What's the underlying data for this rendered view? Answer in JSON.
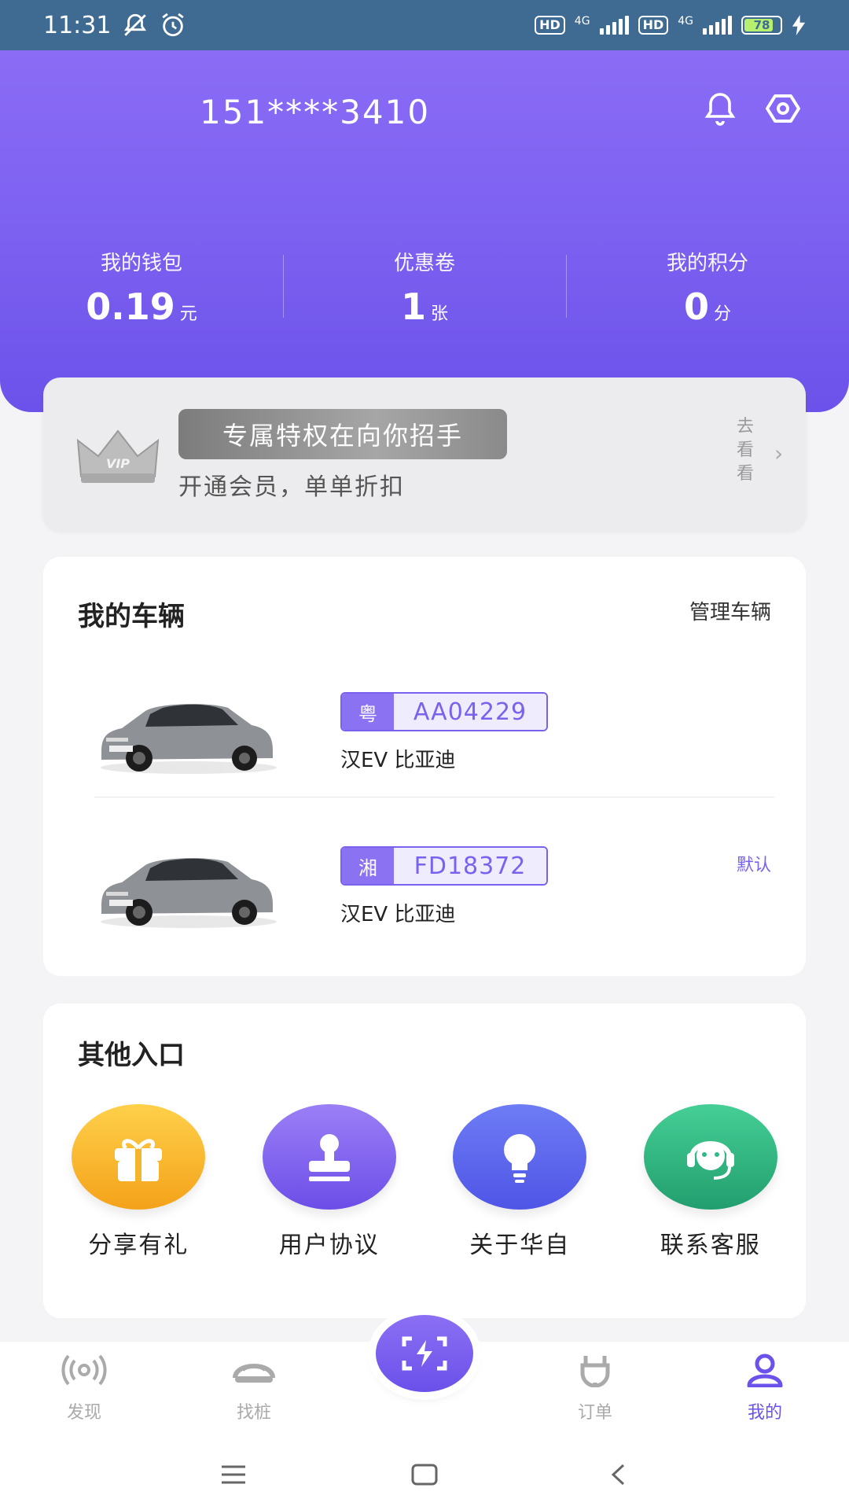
{
  "status_bar": {
    "time": "11:31",
    "net1": "4G",
    "net2": "4G",
    "battery": "78",
    "hd1": "HD",
    "hd2": "HD"
  },
  "header": {
    "phone": "151****3410",
    "icons": [
      "bell-icon",
      "eye-icon"
    ]
  },
  "stats": [
    {
      "label": "我的钱包",
      "value": "0.19",
      "unit": "元"
    },
    {
      "label": "优惠卷",
      "value": "1",
      "unit": "张"
    },
    {
      "label": "我的积分",
      "value": "0",
      "unit": "分"
    }
  ],
  "vip": {
    "badge": "VIP",
    "title": "专属特权在向你招手",
    "subtitle": "开通会员，单单折扣",
    "link": "去看看",
    "chevron": "›"
  },
  "vehicles": {
    "title": "我的车辆",
    "manage": "管理车辆",
    "items": [
      {
        "province": "粤",
        "plate": "AA04229",
        "model": "汉EV 比亚迪",
        "tag": ""
      },
      {
        "province": "湘",
        "plate": "FD18372",
        "model": "汉EV 比亚迪",
        "tag": "默认"
      }
    ]
  },
  "other": {
    "title": "其他入口",
    "items": [
      {
        "label": "分享有礼",
        "icon": "gift-icon",
        "color": "#fbb72c"
      },
      {
        "label": "用户协议",
        "icon": "stamp-icon",
        "color": "#7e5ff0"
      },
      {
        "label": "关于华自",
        "icon": "bulb-icon",
        "color": "#5a62ec"
      },
      {
        "label": "联系客服",
        "icon": "headset-icon",
        "color": "#2fba86"
      }
    ]
  },
  "tabbar": [
    {
      "label": "发现",
      "icon": "radar-icon",
      "active": false
    },
    {
      "label": "找桩",
      "icon": "car-front-icon",
      "active": false
    },
    {
      "label": "订单",
      "icon": "plug-icon",
      "active": false
    },
    {
      "label": "我的",
      "icon": "user-icon",
      "active": true
    }
  ],
  "fab": {
    "icon": "scan-charge-icon"
  },
  "colors": {
    "primary": "#7b5ff0",
    "accent_text": "#6c52ea"
  }
}
